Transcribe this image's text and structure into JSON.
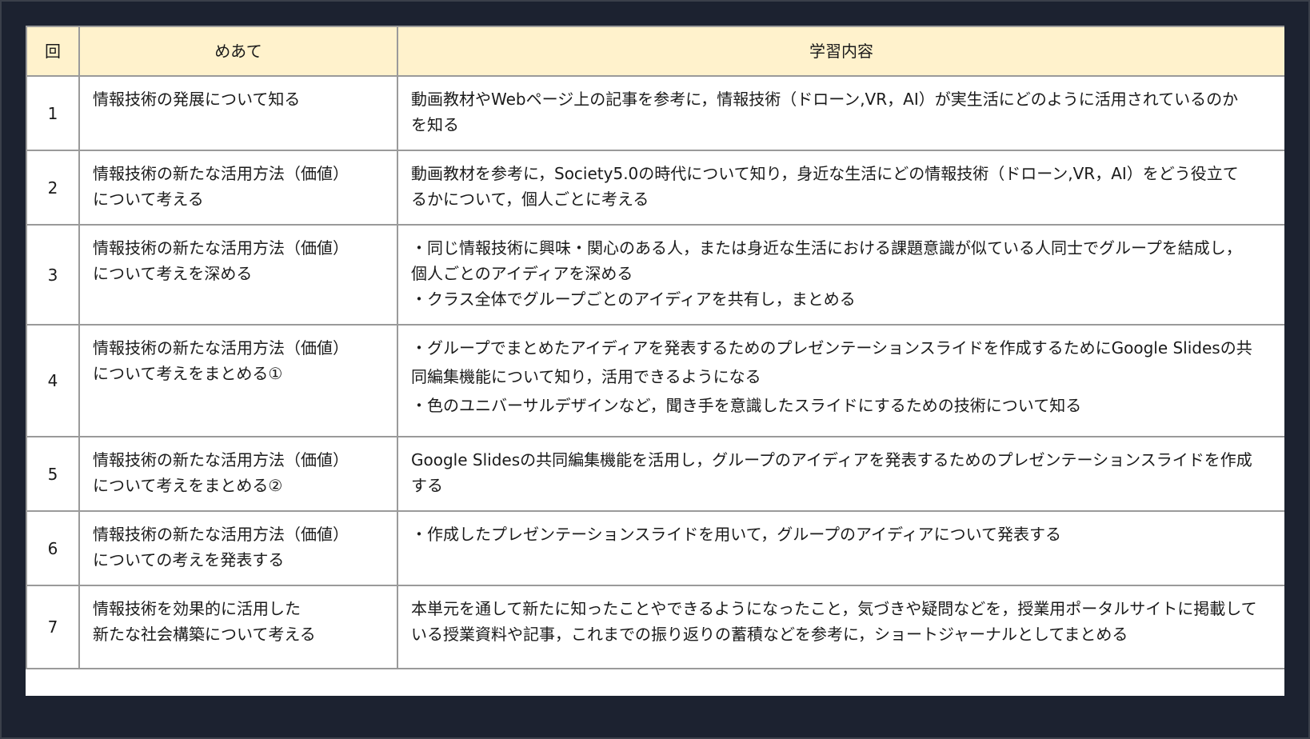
{
  "header": {
    "col_num": "回",
    "col_goal": "めあて",
    "col_content": "学習内容"
  },
  "rows": [
    {
      "num": "1",
      "goal": [
        "情報技術の発展について知る"
      ],
      "content": [
        "動画教材やWebページ上の記事を参考に，情報技術（ドローン,VR，AI）が実生活にどのように活用されているのか",
        "を知る"
      ]
    },
    {
      "num": "2",
      "goal": [
        "情報技術の新たな活用方法（価値）",
        "について考える"
      ],
      "content": [
        "動画教材を参考に，Society5.0の時代について知り，身近な生活にどの情報技術（ドローン,VR，AI）をどう役立て",
        "るかについて，個人ごとに考える"
      ]
    },
    {
      "num": "3",
      "goal": [
        "情報技術の新たな活用方法（価値）",
        "について考えを深める"
      ],
      "content": [
        "・同じ情報技術に興味・関心のある人，または身近な生活における課題意識が似ている人同士でグループを結成し，",
        "個人ごとのアイディアを深める",
        "・クラス全体でグループごとのアイディアを共有し，まとめる"
      ]
    },
    {
      "num": "4",
      "goal": [
        "情報技術の新たな活用方法（価値）",
        "について考えをまとめる①"
      ],
      "content": [
        "・グループでまとめたアイディアを発表するためのプレゼンテーションスライドを作成するためにGoogle Slidesの共",
        "同編集機能について知り，活用できるようになる",
        "・色のユニバーサルデザインなど，聞き手を意識したスライドにするための技術について知る"
      ]
    },
    {
      "num": "5",
      "goal": [
        "情報技術の新たな活用方法（価値）",
        "について考えをまとめる②"
      ],
      "content": [
        "Google Slidesの共同編集機能を活用し，グループのアイディアを発表するためのプレゼンテーションスライドを作成",
        "する"
      ]
    },
    {
      "num": "6",
      "goal": [
        "情報技術の新たな活用方法（価値）",
        "についての考えを発表する"
      ],
      "content": [
        "・作成したプレゼンテーションスライドを用いて，グループのアイディアについて発表する"
      ]
    },
    {
      "num": "7",
      "goal": [
        "情報技術を効果的に活用した",
        "新たな社会構築について考える"
      ],
      "content": [
        "本単元を通して新たに知ったことやできるようになったこと，気づきや疑問などを，授業用ポータルサイトに掲載して",
        "いる授業資料や記事，これまでの振り返りの蓄積などを参考に，ショートジャーナルとしてまとめる"
      ]
    }
  ]
}
